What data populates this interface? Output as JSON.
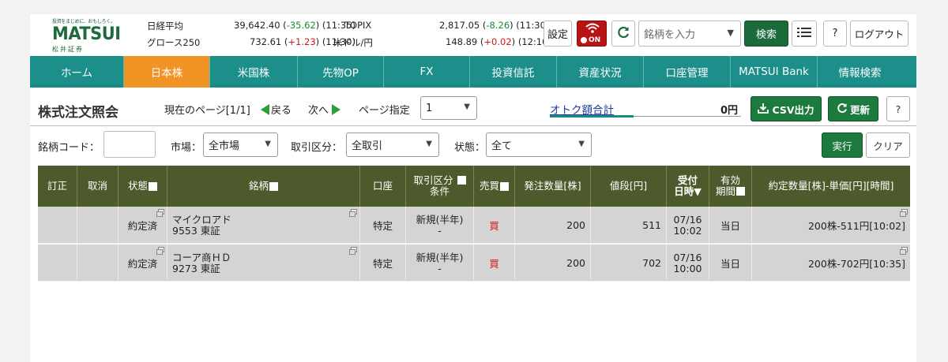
{
  "header": {
    "logo": {
      "tagline": "投資をまじめに、おもしろく。",
      "name": "MATSUI",
      "sub": "松井証券"
    },
    "indices": [
      {
        "name": "日経平均",
        "value": "39,642.40",
        "change": "-35.62",
        "time": "(11:35)",
        "dir": "neg"
      },
      {
        "name": "TOPIX",
        "value": "2,817.05",
        "change": "-8.26",
        "time": "(11:30)",
        "dir": "neg"
      },
      {
        "name": "グロース250",
        "value": "732.61",
        "change": "+1.23",
        "time": "(11:30)",
        "dir": "pos"
      },
      {
        "name": "米ドル/円",
        "value": "148.89",
        "change": "+0.02",
        "time": "(12:10)",
        "dir": "pos"
      }
    ],
    "settings_label": "設定",
    "on_label": "ON",
    "stock_input_placeholder": "銘柄を入力",
    "search_label": "検索",
    "help_label": "?",
    "logout_label": "ログアウト"
  },
  "nav": {
    "items": [
      {
        "label": "ホーム",
        "active": false
      },
      {
        "label": "日本株",
        "active": true
      },
      {
        "label": "米国株",
        "active": false
      },
      {
        "label": "先物OP",
        "active": false
      },
      {
        "label": "FX",
        "active": false
      },
      {
        "label": "投資信託",
        "active": false
      },
      {
        "label": "資産状況",
        "active": false
      },
      {
        "label": "口座管理",
        "active": false
      },
      {
        "label": "MATSUI Bank",
        "active": false
      },
      {
        "label": "情報検索",
        "active": false
      }
    ]
  },
  "titlebar": {
    "title": "株式注文照会",
    "current_page": "現在のページ[1/1]",
    "back": "戻る",
    "next": "次へ",
    "page_select_label": "ページ指定",
    "page_select_value": "1",
    "otoku_label": "オトク額合計",
    "otoku_value": "0円",
    "csv_label": "CSV出力",
    "refresh_label": "更新",
    "help_label": "?"
  },
  "filters": {
    "code_label": "銘柄コード：",
    "code_value": "",
    "market_label": "市場：",
    "market_value": "全市場",
    "trade_label": "取引区分：",
    "trade_value": "全取引",
    "status_label": "状態：",
    "status_value": "全て",
    "run_label": "実行",
    "clear_label": "クリア"
  },
  "table": {
    "headers": {
      "correct": "訂正",
      "cancel": "取消",
      "status": "状態",
      "stock": "銘柄",
      "account": "口座",
      "trade_a": "取引区分",
      "trade_b": "条件",
      "side": "売買",
      "qty": "発注数量[株]",
      "price": "値段[円]",
      "recv_a": "受付",
      "recv_b": "日時▼",
      "valid_a": "有効",
      "valid_b": "期間",
      "exec": "約定数量[株]-単価[円][時間]"
    },
    "rows": [
      {
        "status": "約定済",
        "name": "マイクロアド",
        "code": "9553 東証",
        "account": "特定",
        "trade": "新規(半年)",
        "cond": "-",
        "side": "買",
        "qty": "200",
        "price": "511",
        "date": "07/16",
        "time": "10:02",
        "valid": "当日",
        "exec": "200株-511円[10:02]"
      },
      {
        "status": "約定済",
        "name": "コーア商ＨＤ",
        "code": "9273 東証",
        "account": "特定",
        "trade": "新規(半年)",
        "cond": "-",
        "side": "買",
        "qty": "200",
        "price": "702",
        "date": "07/16",
        "time": "10:00",
        "valid": "当日",
        "exec": "200株-702円[10:35]"
      }
    ]
  }
}
